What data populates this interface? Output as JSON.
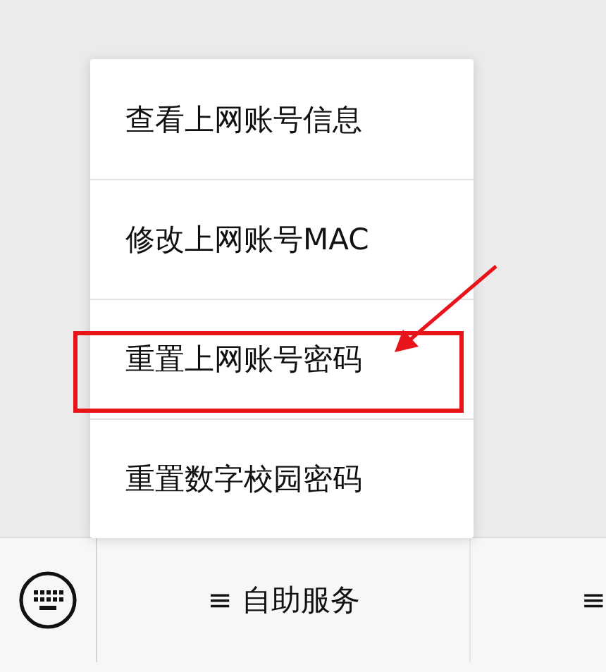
{
  "menu": {
    "items": [
      {
        "label": "查看上网账号信息",
        "highlighted": false
      },
      {
        "label": "修改上网账号MAC",
        "highlighted": false
      },
      {
        "label": "重置上网账号密码",
        "highlighted": true
      },
      {
        "label": "重置数字校园密码",
        "highlighted": false
      }
    ]
  },
  "bottom_bar": {
    "tabs": [
      {
        "label": "≡ 自助服务"
      },
      {
        "label": "≡"
      }
    ]
  }
}
